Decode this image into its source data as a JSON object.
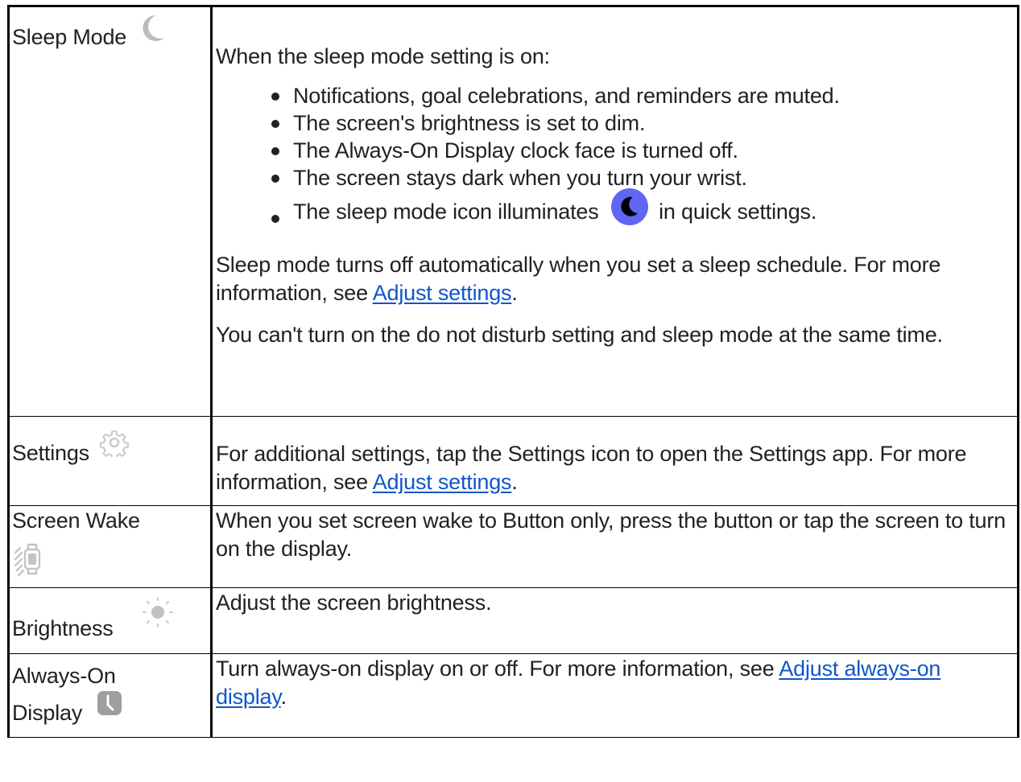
{
  "rows": [
    {
      "feature": "Sleep Mode",
      "icon": "moon-icon",
      "intro": "When the sleep mode setting is on:",
      "bullets": [
        "Notifications, goal celebrations, and reminders are muted.",
        "The screen's brightness is set to dim.",
        "The Always-On Display clock face is turned off.",
        "The screen stays dark when you turn your wrist."
      ],
      "bullet5_before": "The sleep mode icon illuminates",
      "bullet5_after": "in quick settings.",
      "bullet5_icon": "sleep-mode-quick-setting-icon",
      "para2_text": "Sleep mode turns off automatically when you set a sleep schedule. For more information, see ",
      "para2_link": "Adjust settings",
      "para2_end": ".",
      "para3": "You can't turn on the do not disturb setting and sleep mode at the same time."
    },
    {
      "feature": "Settings",
      "icon": "gear-icon",
      "text": "For additional settings, tap the Settings icon to open the Settings app. For more information, see ",
      "link": "Adjust settings",
      "end": "."
    },
    {
      "feature": "Screen Wake",
      "icon": "screen-wake-icon",
      "text": "When you set screen wake to Button only, press the button or tap the screen to turn on the display."
    },
    {
      "feature": "Brightness",
      "icon": "brightness-icon",
      "text": "Adjust the screen brightness."
    },
    {
      "feature_line1": "Always-On",
      "feature_line2": "Display",
      "icon": "clock-icon",
      "text": "Turn always-on display on or off. For more information, see ",
      "link": "Adjust always-on display",
      "end": "."
    }
  ],
  "colors": {
    "text": "#202124",
    "link": "#1155cc",
    "icon_gray": "#bdbdbd",
    "sleep_icon_bg": "#5f66f3"
  }
}
